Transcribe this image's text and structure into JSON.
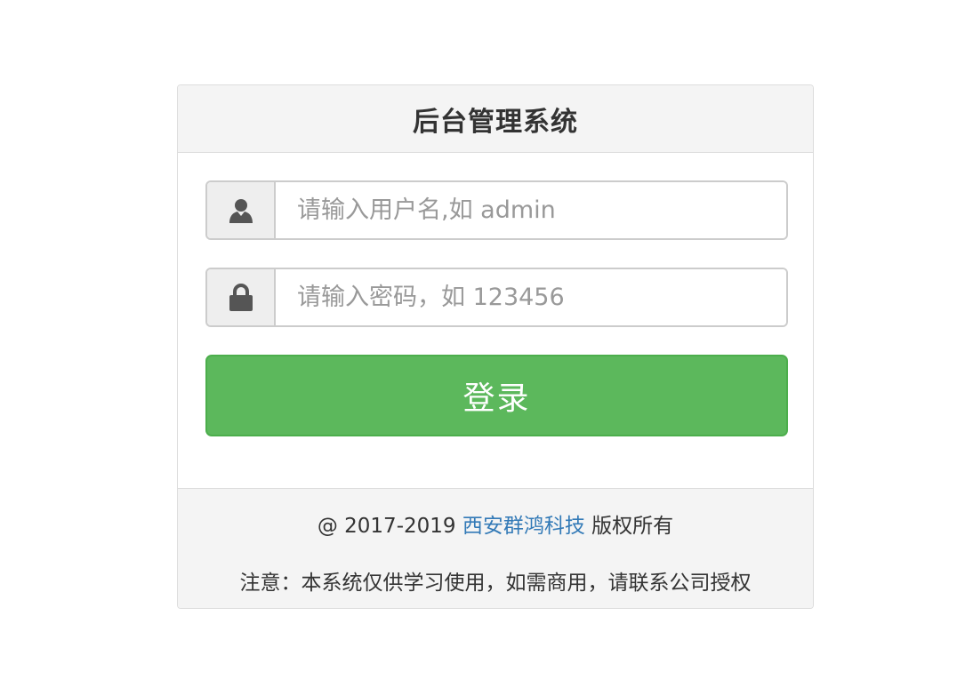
{
  "panel": {
    "title": "后台管理系统"
  },
  "form": {
    "username": {
      "icon": "user-icon",
      "placeholder": "请输入用户名,如 admin",
      "value": ""
    },
    "password": {
      "icon": "lock-icon",
      "placeholder": "请输入密码，如 123456",
      "value": ""
    },
    "login_label": "登录"
  },
  "footer": {
    "copyright_prefix": "@ 2017-2019",
    "company_link": "西安群鸿科技",
    "copyright_suffix": "版权所有",
    "notice": "注意：本系统仅供学习使用，如需商用，请联系公司授权"
  },
  "colors": {
    "primary_button": "#5cb85c",
    "link": "#337ab7",
    "panel_heading_bg": "#f4f4f4"
  }
}
